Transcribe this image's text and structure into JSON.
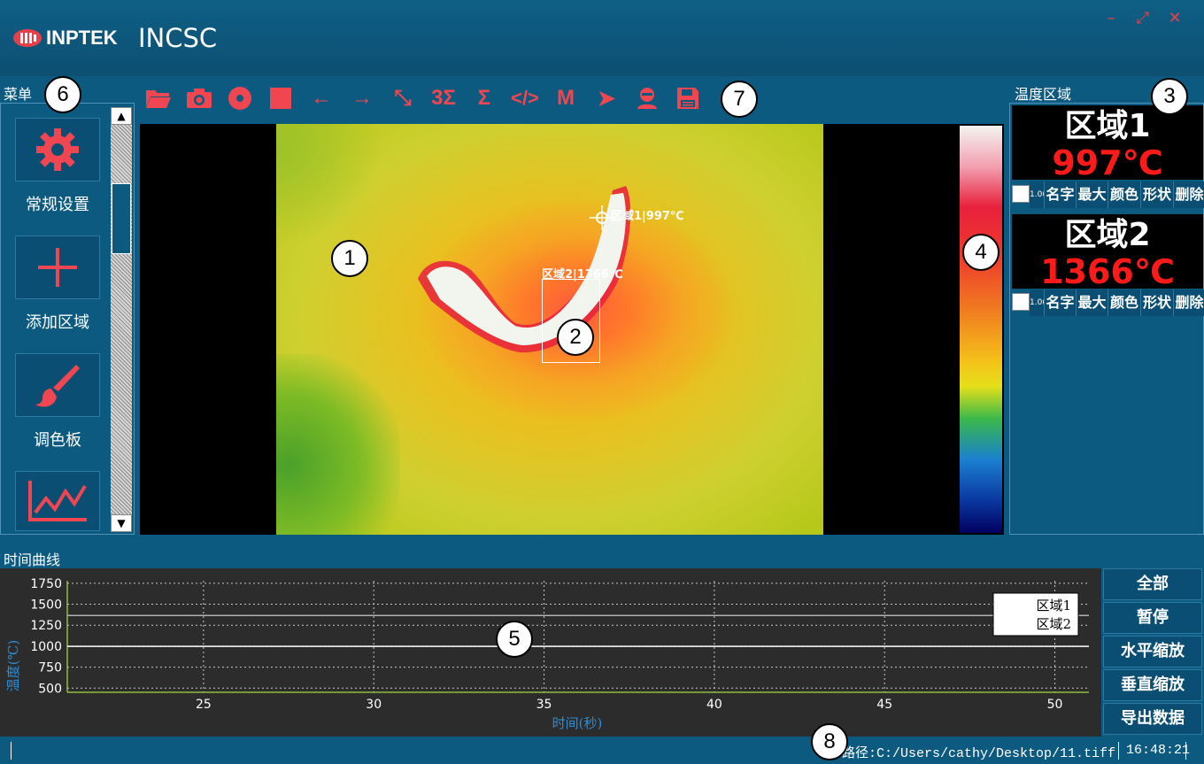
{
  "app": {
    "brand": "INPTEK",
    "name": "INCSC"
  },
  "window_controls": {
    "minimize": "–",
    "maximize": "⤢",
    "close": "✕"
  },
  "menu": {
    "title": "菜单",
    "items": [
      {
        "label": "常规设置",
        "icon": "gear-icon"
      },
      {
        "label": "添加区域",
        "icon": "plus-icon"
      },
      {
        "label": "调色板",
        "icon": "brush-icon"
      },
      {
        "label": "",
        "icon": "line-chart-icon"
      }
    ]
  },
  "toolbar": {
    "items": [
      {
        "name": "open-folder-icon",
        "glyph": ""
      },
      {
        "name": "camera-icon",
        "glyph": ""
      },
      {
        "name": "record-icon",
        "glyph": ""
      },
      {
        "name": "stop-icon",
        "glyph": ""
      },
      {
        "name": "arrow-left-icon",
        "glyph": "←"
      },
      {
        "name": "arrow-right-icon",
        "glyph": "→"
      },
      {
        "name": "fit-icon",
        "glyph": "⤡"
      },
      {
        "name": "three-sigma-icon",
        "glyph": "3Σ"
      },
      {
        "name": "sigma-icon",
        "glyph": "Σ"
      },
      {
        "name": "code-icon",
        "glyph": "</>"
      },
      {
        "name": "m-icon",
        "glyph": "M"
      },
      {
        "name": "send-icon",
        "glyph": "➤"
      },
      {
        "name": "user-icon",
        "glyph": ""
      },
      {
        "name": "save-icon",
        "glyph": ""
      }
    ]
  },
  "thermal": {
    "roi1_label": "区域1|997℃",
    "roi2_label": "区域2|1366℃"
  },
  "temp_regions": {
    "title": "温度区域",
    "regions": [
      {
        "name": "区域1",
        "temp": "997℃",
        "small": "1.0(",
        "cols": [
          "名字",
          "最大",
          "颜色",
          "形状",
          "删除"
        ]
      },
      {
        "name": "区域2",
        "temp": "1366℃",
        "small": "1.0(",
        "cols": [
          "名字",
          "最大",
          "颜色",
          "形状",
          "删除"
        ]
      }
    ]
  },
  "time_curve": {
    "title": "时间曲线",
    "buttons": [
      "全部",
      "暂停",
      "水平缩放",
      "垂直缩放",
      "导出数据"
    ]
  },
  "chart_data": {
    "type": "line",
    "xlabel": "时间(秒)",
    "ylabel": "温度(℃)",
    "xlim": [
      21,
      51
    ],
    "ylim": [
      450,
      1780
    ],
    "xticks": [
      25,
      30,
      35,
      40,
      45,
      50
    ],
    "yticks": [
      500,
      750,
      1000,
      1250,
      1500,
      1750
    ],
    "grid": true,
    "legend": "top-right",
    "series": [
      {
        "name": "区域1",
        "x": [
          21,
          51
        ],
        "values": [
          997,
          997
        ],
        "color": "#ffffff"
      },
      {
        "name": "区域2",
        "x": [
          21,
          51
        ],
        "values": [
          1366,
          1366
        ],
        "color": "#b0b0b0"
      }
    ]
  },
  "status": {
    "path": "路径:C:/Users/cathy/Desktop/11.tiff",
    "time": "16:48:21"
  },
  "callouts": [
    "1",
    "2",
    "3",
    "4",
    "5",
    "6",
    "7",
    "8"
  ]
}
